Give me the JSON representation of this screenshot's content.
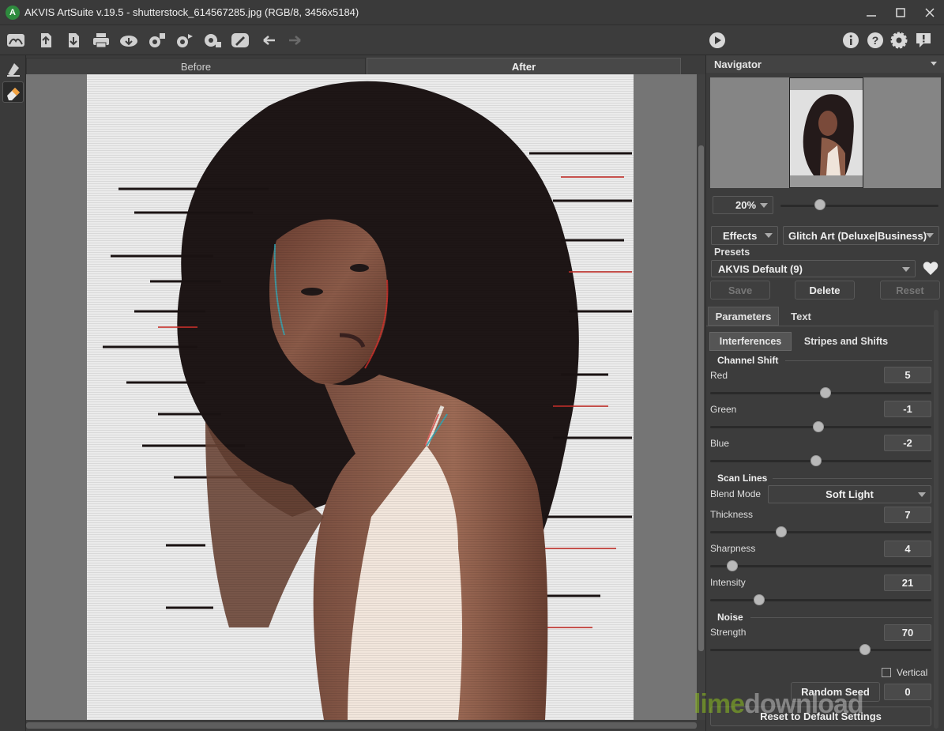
{
  "window": {
    "title": "AKVIS ArtSuite v.19.5 - shutterstock_614567285.jpg (RGB/8, 3456x5184)",
    "logo_letter": "A"
  },
  "toolbar": {
    "icons": [
      "home-icon",
      "open-icon",
      "save-icon",
      "print-icon",
      "share-icon",
      "batch-icon",
      "plugin-icon",
      "settings-gear-icon",
      "brush-icon",
      "undo-icon",
      "redo-icon",
      "run-icon",
      "info-icon",
      "help-icon",
      "preferences-icon",
      "notifications-icon"
    ]
  },
  "view_tabs": {
    "before": "Before",
    "after": "After"
  },
  "navigator": {
    "title": "Navigator",
    "zoom": "20%",
    "zoom_level": 0.25
  },
  "effects": {
    "category": "Effects",
    "effect": "Glitch Art (Deluxe|Business)"
  },
  "presets": {
    "label": "Presets",
    "selected": "AKVIS Default (9)",
    "save": "Save",
    "delete": "Delete",
    "reset": "Reset"
  },
  "param_tabs": {
    "parameters": "Parameters",
    "text": "Text"
  },
  "sub_tabs": {
    "interferences": "Interferences",
    "stripes": "Stripes and Shifts"
  },
  "channel_shift": {
    "title": "Channel Shift",
    "red": {
      "label": "Red",
      "value": "5",
      "pos": 0.52
    },
    "green": {
      "label": "Green",
      "value": "-1",
      "pos": 0.49
    },
    "blue": {
      "label": "Blue",
      "value": "-2",
      "pos": 0.48
    }
  },
  "scan_lines": {
    "title": "Scan Lines",
    "blend_label": "Blend Mode",
    "blend_value": "Soft Light",
    "thickness": {
      "label": "Thickness",
      "value": "7",
      "pos": 0.32
    },
    "sharpness": {
      "label": "Sharpness",
      "value": "4",
      "pos": 0.1
    },
    "intensity": {
      "label": "Intensity",
      "value": "21",
      "pos": 0.22
    }
  },
  "noise": {
    "title": "Noise",
    "strength": {
      "label": "Strength",
      "value": "70",
      "pos": 0.7
    }
  },
  "bottom": {
    "vertical_label": "Vertical",
    "random_seed": "Random Seed",
    "seed_value": "0",
    "reset_defaults": "Reset to Default Settings"
  },
  "watermark": {
    "lime": "lime",
    "rest": "download"
  },
  "colors": {
    "panel": "#3c3c3c",
    "accent_green": "#8dbf1f"
  }
}
